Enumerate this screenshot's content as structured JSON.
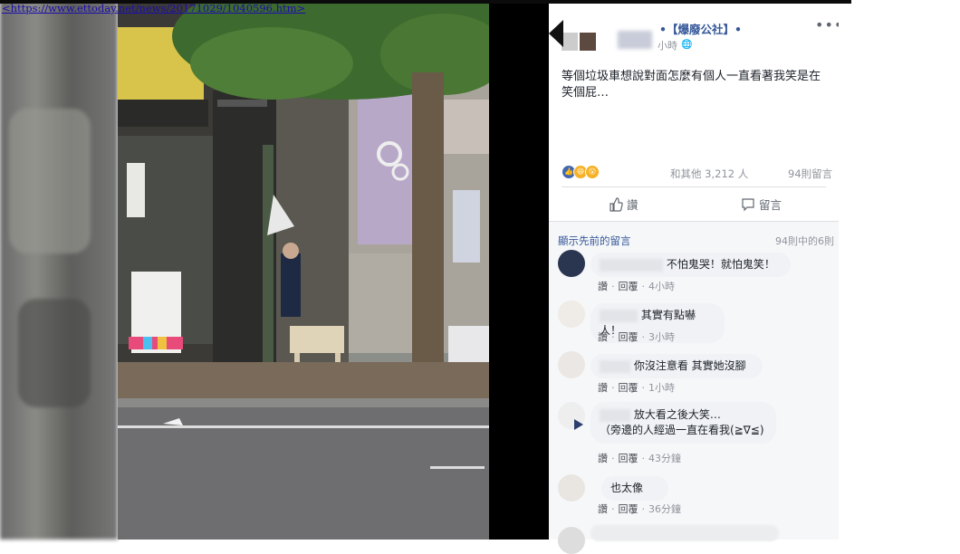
{
  "browser": {
    "url_text": "<https://www.ettoday.net/news/20171029/1040596.htm>"
  },
  "post": {
    "page_name": "•【爆廢公社】•",
    "time": "小時",
    "globe": "🌐",
    "more": "•••",
    "text": "等個垃圾車想說對面怎麼有個人一直看著我笑是在笑個屁…",
    "reaction_count": "和其他 3,212 人",
    "comment_count": "94則留言",
    "like_label": "讚",
    "comment_label": "留言"
  },
  "comments_header": {
    "prev_link": "顯示先前的留言",
    "pager": "94則中的6則"
  },
  "comments": [
    {
      "text": "不怕鬼哭！就怕鬼笑！",
      "like": "讚",
      "reply": "回覆",
      "time": "4小時"
    },
    {
      "text": "其實有點嚇人！",
      "like": "讚",
      "reply": "回覆",
      "time": "3小時"
    },
    {
      "text": "你沒注意看 其實她沒腳",
      "like": "讚",
      "reply": "回覆",
      "time": "1小時"
    },
    {
      "text_line1": "放大看之後大笑…",
      "text_line2": "（旁邊的人經過一直在看我(≧∇≦)",
      "like": "讚",
      "reply": "回覆",
      "time": "43分鐘"
    },
    {
      "text": "也太像",
      "like": "讚",
      "reply": "回覆",
      "time": "36分鐘"
    }
  ],
  "colors": {
    "link_blue": "#365899",
    "text_dark": "#1d2129",
    "meta_gray": "#90949c",
    "like_blue": "#4267b2"
  }
}
